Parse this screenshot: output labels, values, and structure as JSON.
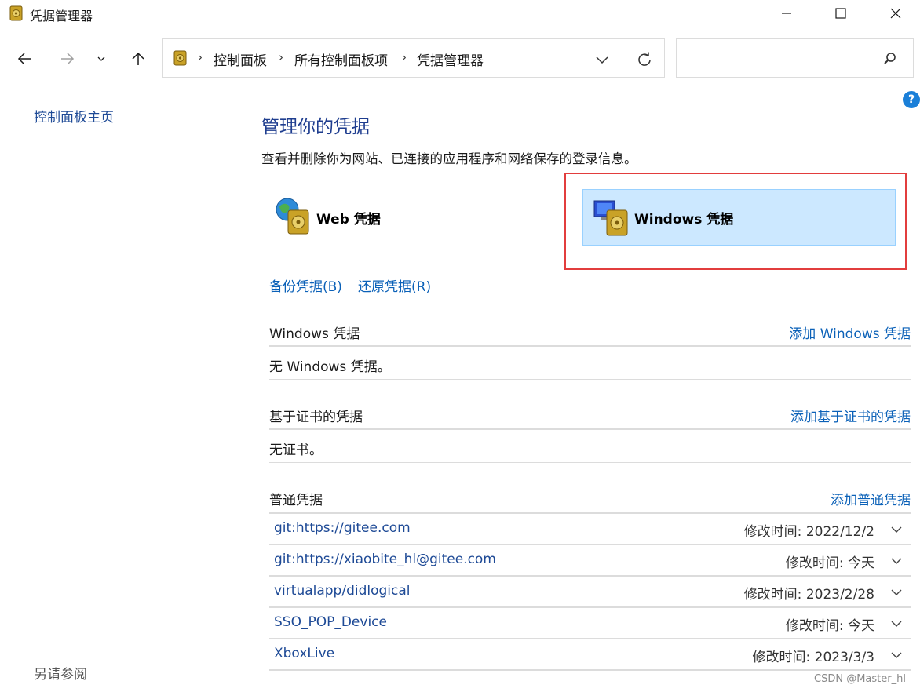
{
  "window": {
    "title": "凭据管理器"
  },
  "address_bar": {
    "crumbs": [
      "控制面板",
      "所有控制面板项",
      "凭据管理器"
    ],
    "search_value": ""
  },
  "left_pane": {
    "home_link": "控制面板主页",
    "see_also": "另请参阅"
  },
  "main": {
    "heading": "管理你的凭据",
    "description": "查看并删除你为网站、已连接的应用程序和网络保存的登录信息。",
    "categories": [
      {
        "label": "Web 凭据",
        "selected": false
      },
      {
        "label": "Windows 凭据",
        "selected": true
      }
    ],
    "backup_link": "备份凭据(B)",
    "restore_link": "还原凭据(R)",
    "sections": {
      "windows": {
        "title": "Windows 凭据",
        "add_link": "添加 Windows 凭据",
        "empty_text": "无 Windows 凭据。"
      },
      "certificate": {
        "title": "基于证书的凭据",
        "add_link": "添加基于证书的凭据",
        "empty_text": "无证书。"
      },
      "generic": {
        "title": "普通凭据",
        "add_link": "添加普通凭据",
        "items": [
          {
            "name": "git:https://gitee.com",
            "modified": "修改时间:  2022/12/2"
          },
          {
            "name": "git:https://xiaobite_hl@gitee.com",
            "modified": "修改时间:  今天"
          },
          {
            "name": "virtualapp/didlogical",
            "modified": "修改时间:  2023/2/28"
          },
          {
            "name": "SSO_POP_Device",
            "modified": "修改时间:  今天"
          },
          {
            "name": "XboxLive",
            "modified": "修改时间:  2023/3/3"
          }
        ]
      }
    }
  },
  "watermark": "CSDN @Master_hl",
  "colors": {
    "link": "#0b61b8",
    "heading": "#1e3d8f",
    "selected_tile": "#cce8ff",
    "highlight_border": "#e23d3d"
  }
}
